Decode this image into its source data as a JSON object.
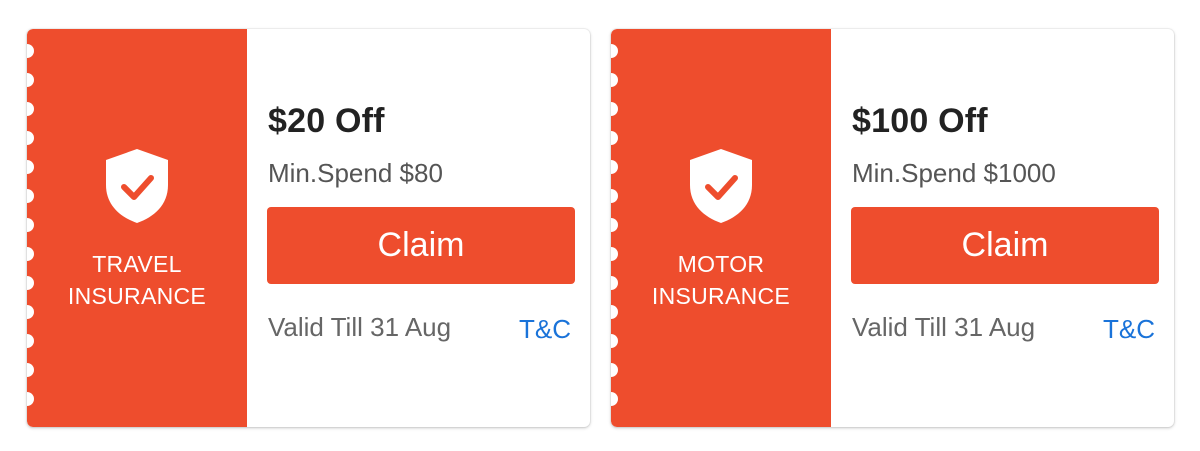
{
  "vouchers": [
    {
      "category_line1": "TRAVEL",
      "category_line2": "INSURANCE",
      "discount": "$20 Off",
      "min_spend": "Min.Spend $80",
      "claim_label": "Claim",
      "validity": "Valid Till 31 Aug",
      "terms_label": "T&C",
      "icon": "shield-check-icon"
    },
    {
      "category_line1": "MOTOR",
      "category_line2": "INSURANCE",
      "discount": "$100 Off",
      "min_spend": "Min.Spend $1000",
      "claim_label": "Claim",
      "validity": "Valid Till 31 Aug",
      "terms_label": "T&C",
      "icon": "shield-check-icon"
    }
  ],
  "colors": {
    "brand": "#ee4d2d",
    "link": "#1a73d9",
    "text_primary": "#222222",
    "text_secondary": "#555555"
  }
}
